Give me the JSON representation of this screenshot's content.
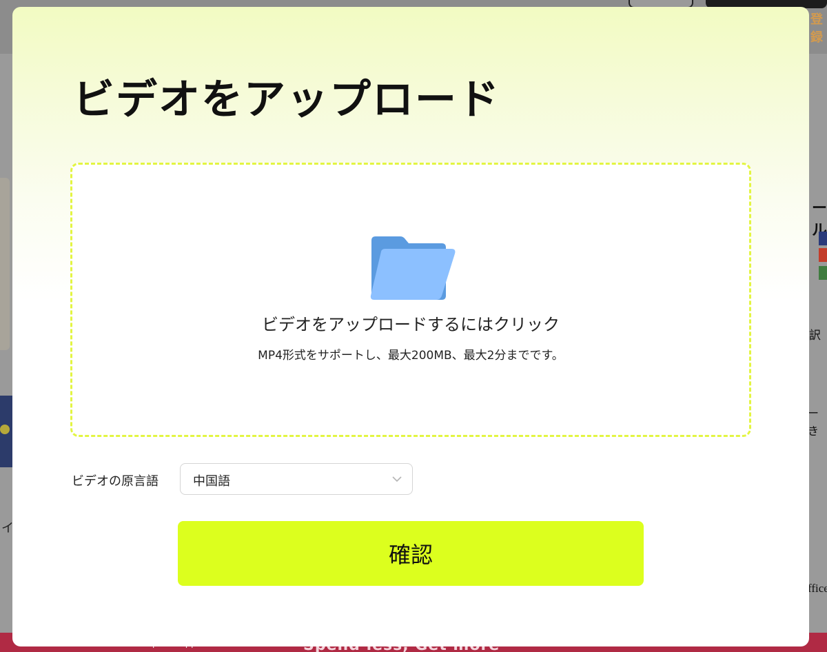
{
  "background": {
    "register_text": "登録",
    "right_heading": "ール",
    "right_text": "訳",
    "right_dash": "ー",
    "right_ki": "き",
    "right_office": "ffice",
    "left_text": "イ",
    "bottom_search": "Search AliExpress App",
    "bottom_slogan": "Spend less, Get more"
  },
  "modal": {
    "title": "ビデオをアップロード",
    "dropzone": {
      "icon": "folder-icon",
      "main_text": "ビデオをアップロードするにはクリック",
      "sub_text": "MP4形式をサポートし、最大200MB、最大2分までです。"
    },
    "language": {
      "label": "ビデオの原言語",
      "selected": "中国語"
    },
    "confirm_label": "確認"
  },
  "colors": {
    "accent": "#dcff1e",
    "dropzone_border": "#e3f542",
    "folder_back": "#5b9be0",
    "folder_front": "#8cc0ff"
  }
}
